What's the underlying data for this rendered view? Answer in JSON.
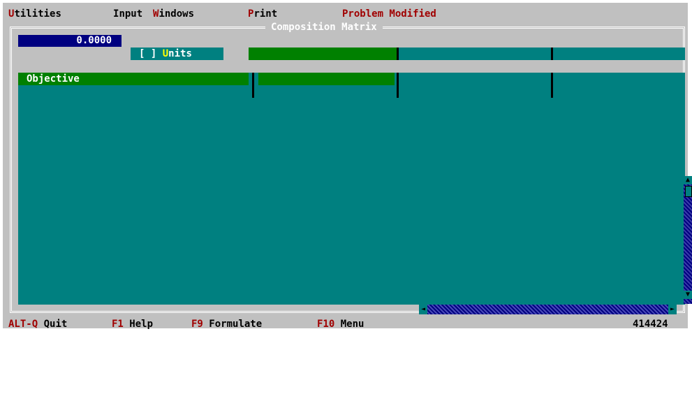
{
  "menu": {
    "items": [
      {
        "hot": "U",
        "rest": "tilities"
      },
      {
        "hot": "I",
        "rest": "nput"
      },
      {
        "pre": "",
        "hot": "W",
        "rest": "indows"
      },
      {
        "hot": "P",
        "rest": "rint"
      }
    ],
    "status": "Problem Modified"
  },
  "window": {
    "title": "Composition Matrix"
  },
  "current_value": "0.0000",
  "units_toggle": {
    "checkbox": "[ ]",
    "hot": "U",
    "rest": "nits"
  },
  "rows": [
    {
      "label": "Objective"
    }
  ],
  "statusbar": {
    "keys": [
      {
        "key": "ALT-Q",
        "label": "Quit"
      },
      {
        "key": "F1",
        "label": "Help"
      },
      {
        "key": "F9",
        "label": "Formulate"
      },
      {
        "key": "F10",
        "label": "Menu"
      }
    ],
    "memory": "414424"
  },
  "colors": {
    "background": "#c0c0c0",
    "grid": "#008080",
    "highlight": "#008000",
    "value_box": "#000080",
    "hotkey": "#a00000"
  },
  "icons": {
    "scroll_up": "triangle-up-icon",
    "scroll_down": "triangle-down-icon",
    "scroll_left": "triangle-left-icon",
    "scroll_right": "triangle-right-icon"
  }
}
